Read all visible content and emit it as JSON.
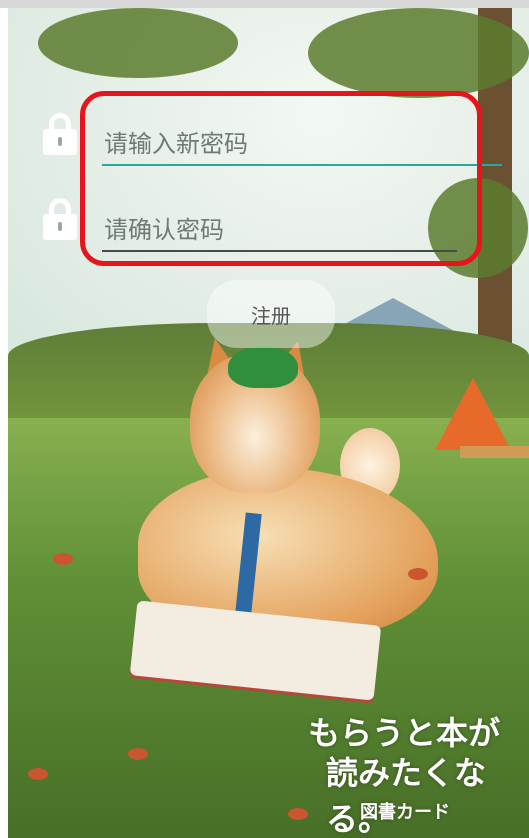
{
  "form": {
    "new_password_placeholder": "请输入新密码",
    "confirm_password_placeholder": "请确认密码",
    "register_label": "注册"
  },
  "background": {
    "slogan_line1": "もらうと本が",
    "slogan_line2": "読みたくなる。",
    "card_label": "図書カード"
  },
  "colors": {
    "highlight": "#e6141b",
    "new_password_underline": "#2aa8a0",
    "confirm_password_underline": "#4a4a4a"
  }
}
